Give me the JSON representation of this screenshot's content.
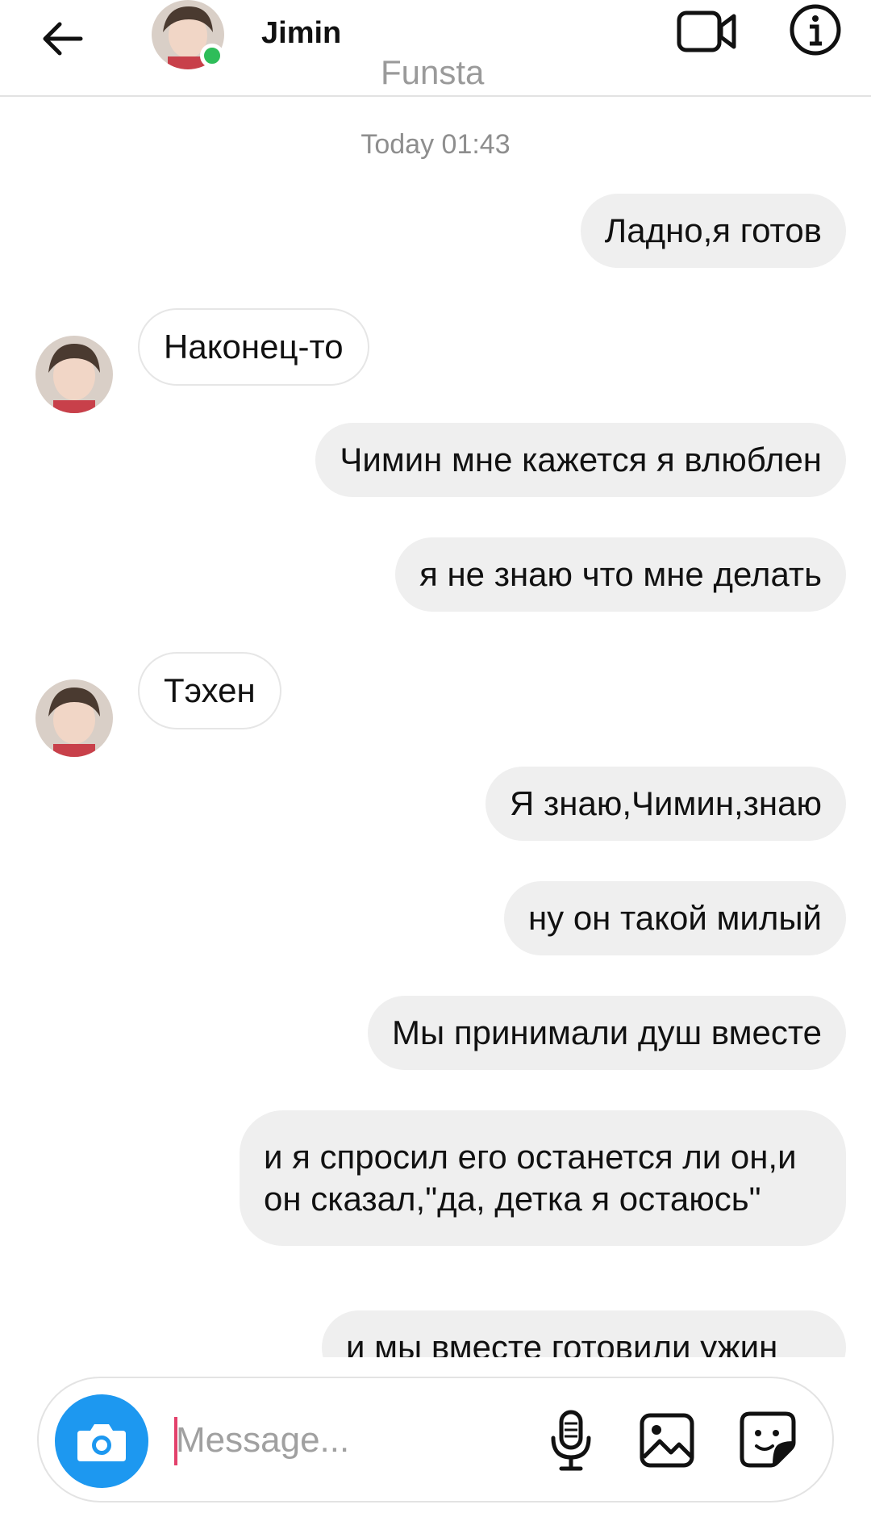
{
  "header": {
    "contact_name": "Jimin",
    "contact_subtitle": "Funsta",
    "online": true
  },
  "chat": {
    "timestamp": "Today 01:43",
    "messages": [
      {
        "direction": "out",
        "text": "Ладно,я готов"
      },
      {
        "direction": "in",
        "text": "Наконец-то"
      },
      {
        "direction": "out",
        "text": "Чимин мне кажется я влюблен"
      },
      {
        "direction": "out",
        "text": "я не знаю что мне делать"
      },
      {
        "direction": "in",
        "text": "Тэхен"
      },
      {
        "direction": "out",
        "text": "Я знаю,Чимин,знаю"
      },
      {
        "direction": "out",
        "text": "ну он такой милый"
      },
      {
        "direction": "out",
        "text": "Мы принимали душ вместе"
      },
      {
        "direction": "out",
        "text": "и я спросил его останется ли он,и он сказал,\"да, детка я остаюсь\""
      },
      {
        "direction": "out",
        "text": "и мы вместе готовили ужин"
      }
    ]
  },
  "composer": {
    "placeholder": "Message...",
    "value": ""
  },
  "icons": {
    "back": "back-arrow-icon",
    "video": "video-call-icon",
    "info": "info-icon",
    "camera": "camera-icon",
    "mic": "microphone-icon",
    "gallery": "gallery-icon",
    "sticker": "sticker-icon"
  },
  "colors": {
    "online_dot": "#2ebd59",
    "camera_button": "#1d98f0",
    "outgoing_bubble": "#efefef",
    "cursor": "#e3416b"
  }
}
